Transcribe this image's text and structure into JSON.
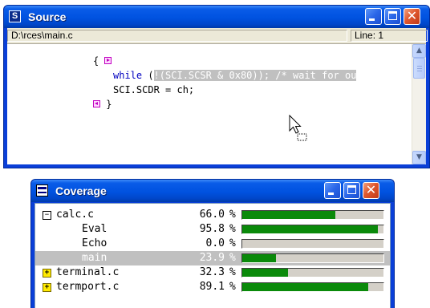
{
  "source_window": {
    "title": "Source",
    "icon_letter": "S",
    "file_path": "D:\\rces\\main.c",
    "line_indicator": "Line: 1",
    "code": {
      "open_brace": "{",
      "while_keyword": "while",
      "while_open": " (",
      "selected_text": "!(SCI.SCSR & 0x80)); /* wait for ou",
      "assign_line": "SCI.SCDR = ch;",
      "close_brace": "}"
    }
  },
  "coverage_window": {
    "title": "Coverage",
    "rows": [
      {
        "name": "calc.c",
        "percent": "66.0",
        "pct_sign": "%",
        "expander": "minus",
        "coverage": 66.0
      },
      {
        "name": "Eval",
        "percent": "95.8",
        "pct_sign": "%",
        "expander": "",
        "coverage": 95.8
      },
      {
        "name": "Echo",
        "percent": "0.0",
        "pct_sign": "%",
        "expander": "",
        "coverage": 0.0
      },
      {
        "name": "main",
        "percent": "23.9",
        "pct_sign": "%",
        "expander": "",
        "coverage": 23.9,
        "selected": true
      },
      {
        "name": "terminal.c",
        "percent": "32.3",
        "pct_sign": "%",
        "expander": "plus",
        "coverage": 32.3
      },
      {
        "name": "termport.c",
        "percent": "89.1",
        "pct_sign": "%",
        "expander": "plus",
        "coverage": 89.1
      }
    ]
  },
  "colors": {
    "titlebar_blue": "#0052e0",
    "coverage_fill": "#0a8a0a",
    "keyword": "#0000c0",
    "marker": "#c000c0",
    "selection": "#c0c0c0"
  },
  "icons": [
    "source-app-icon",
    "minimize-icon",
    "maximize-icon",
    "close-icon",
    "coverage-app-icon",
    "expand-icon",
    "collapse-icon",
    "breakpoint-marker-icon",
    "mouse-pointer-icon"
  ]
}
